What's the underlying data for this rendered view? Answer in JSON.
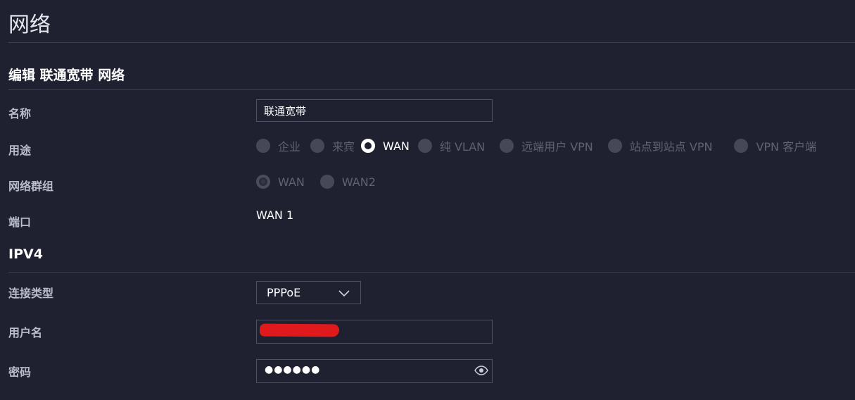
{
  "page": {
    "title": "网络"
  },
  "edit_section": {
    "title": "编辑 联通宽带 网络"
  },
  "fields": {
    "name": {
      "label": "名称",
      "value": "联通宽带"
    },
    "purpose": {
      "label": "用途",
      "options": [
        "企业",
        "来宾",
        "WAN",
        "纯 VLAN",
        "远端用户 VPN",
        "站点到站点 VPN",
        "VPN 客户端"
      ],
      "selected": "WAN"
    },
    "network_group": {
      "label": "网络群组",
      "options": [
        "WAN",
        "WAN2"
      ],
      "selected": "WAN"
    },
    "port": {
      "label": "端口",
      "value": "WAN 1"
    }
  },
  "ipv4_section": {
    "title": "IPV4",
    "connection_type": {
      "label": "连接类型",
      "value": "PPPoE"
    },
    "username": {
      "label": "用户名"
    },
    "password": {
      "label": "密码",
      "masked_value": "●●●●●●"
    }
  },
  "colors": {
    "background": "#1f2130",
    "border": "#4e5163",
    "redaction": "#e0191c"
  },
  "icons": {
    "select_arrow": "chevron-down-icon",
    "show_password": "eye-icon"
  }
}
